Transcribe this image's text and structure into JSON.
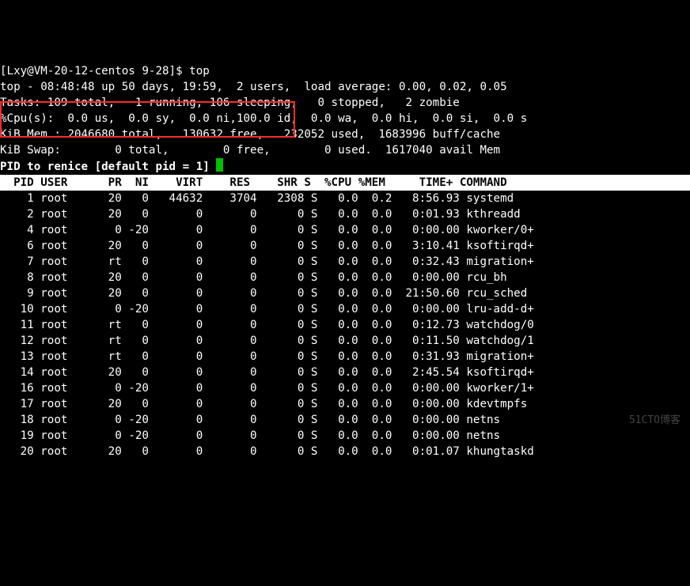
{
  "promptLine": "[Lxy@VM-20-12-centos 9-28]$ top",
  "summary": {
    "l1a": "top - 08:48:48 up 50 days, 19:59,  2 users,  load average: 0.00, 0.02, 0.05",
    "l2": "Tasks: 109 total,   1 running, 106 sleeping,   0 stopped,   2 zombie",
    "l3": "%Cpu(s):  0.0 us,  0.0 sy,  0.0 ni,100.0 id,  0.0 wa,  0.0 hi,  0.0 si,  0.0 s",
    "l4": "KiB Mem : 2046680 total,   130632 free,   232052 used,  1683996 buff/cache",
    "l5": "KiB Swap:        0 total,        0 free,        0 used.  1617040 avail Mem"
  },
  "renicePrompt": "PID to renice [default pid = 1] ",
  "columns": "  PID USER      PR  NI    VIRT    RES    SHR S  %CPU %MEM     TIME+ COMMAND   ",
  "rows": [
    {
      "pid": "1",
      "user": "root",
      "pr": "20",
      "ni": "0",
      "virt": "44632",
      "res": "3704",
      "shr": "2308",
      "s": "S",
      "cpu": "0.0",
      "mem": "0.2",
      "time": "8:56.93",
      "cmd": "systemd"
    },
    {
      "pid": "2",
      "user": "root",
      "pr": "20",
      "ni": "0",
      "virt": "0",
      "res": "0",
      "shr": "0",
      "s": "S",
      "cpu": "0.0",
      "mem": "0.0",
      "time": "0:01.93",
      "cmd": "kthreadd"
    },
    {
      "pid": "4",
      "user": "root",
      "pr": "0",
      "ni": "-20",
      "virt": "0",
      "res": "0",
      "shr": "0",
      "s": "S",
      "cpu": "0.0",
      "mem": "0.0",
      "time": "0:00.00",
      "cmd": "kworker/0+"
    },
    {
      "pid": "6",
      "user": "root",
      "pr": "20",
      "ni": "0",
      "virt": "0",
      "res": "0",
      "shr": "0",
      "s": "S",
      "cpu": "0.0",
      "mem": "0.0",
      "time": "3:10.41",
      "cmd": "ksoftirqd+"
    },
    {
      "pid": "7",
      "user": "root",
      "pr": "rt",
      "ni": "0",
      "virt": "0",
      "res": "0",
      "shr": "0",
      "s": "S",
      "cpu": "0.0",
      "mem": "0.0",
      "time": "0:32.43",
      "cmd": "migration+"
    },
    {
      "pid": "8",
      "user": "root",
      "pr": "20",
      "ni": "0",
      "virt": "0",
      "res": "0",
      "shr": "0",
      "s": "S",
      "cpu": "0.0",
      "mem": "0.0",
      "time": "0:00.00",
      "cmd": "rcu_bh"
    },
    {
      "pid": "9",
      "user": "root",
      "pr": "20",
      "ni": "0",
      "virt": "0",
      "res": "0",
      "shr": "0",
      "s": "S",
      "cpu": "0.0",
      "mem": "0.0",
      "time": "21:50.60",
      "cmd": "rcu_sched"
    },
    {
      "pid": "10",
      "user": "root",
      "pr": "0",
      "ni": "-20",
      "virt": "0",
      "res": "0",
      "shr": "0",
      "s": "S",
      "cpu": "0.0",
      "mem": "0.0",
      "time": "0:00.00",
      "cmd": "lru-add-d+"
    },
    {
      "pid": "11",
      "user": "root",
      "pr": "rt",
      "ni": "0",
      "virt": "0",
      "res": "0",
      "shr": "0",
      "s": "S",
      "cpu": "0.0",
      "mem": "0.0",
      "time": "0:12.73",
      "cmd": "watchdog/0"
    },
    {
      "pid": "12",
      "user": "root",
      "pr": "rt",
      "ni": "0",
      "virt": "0",
      "res": "0",
      "shr": "0",
      "s": "S",
      "cpu": "0.0",
      "mem": "0.0",
      "time": "0:11.50",
      "cmd": "watchdog/1"
    },
    {
      "pid": "13",
      "user": "root",
      "pr": "rt",
      "ni": "0",
      "virt": "0",
      "res": "0",
      "shr": "0",
      "s": "S",
      "cpu": "0.0",
      "mem": "0.0",
      "time": "0:31.93",
      "cmd": "migration+"
    },
    {
      "pid": "14",
      "user": "root",
      "pr": "20",
      "ni": "0",
      "virt": "0",
      "res": "0",
      "shr": "0",
      "s": "S",
      "cpu": "0.0",
      "mem": "0.0",
      "time": "2:45.54",
      "cmd": "ksoftirqd+"
    },
    {
      "pid": "16",
      "user": "root",
      "pr": "0",
      "ni": "-20",
      "virt": "0",
      "res": "0",
      "shr": "0",
      "s": "S",
      "cpu": "0.0",
      "mem": "0.0",
      "time": "0:00.00",
      "cmd": "kworker/1+"
    },
    {
      "pid": "17",
      "user": "root",
      "pr": "20",
      "ni": "0",
      "virt": "0",
      "res": "0",
      "shr": "0",
      "s": "S",
      "cpu": "0.0",
      "mem": "0.0",
      "time": "0:00.00",
      "cmd": "kdevtmpfs"
    },
    {
      "pid": "18",
      "user": "root",
      "pr": "0",
      "ni": "-20",
      "virt": "0",
      "res": "0",
      "shr": "0",
      "s": "S",
      "cpu": "0.0",
      "mem": "0.0",
      "time": "0:00.00",
      "cmd": "netns"
    },
    {
      "pid": "19",
      "user": "root",
      "pr": "0",
      "ni": "-20",
      "virt": "0",
      "res": "0",
      "shr": "0",
      "s": "S",
      "cpu": "0.0",
      "mem": "0.0",
      "time": "0:00.00",
      "cmd": "netns"
    },
    {
      "pid": "20",
      "user": "root",
      "pr": "20",
      "ni": "0",
      "virt": "0",
      "res": "0",
      "shr": "0",
      "s": "S",
      "cpu": "0.0",
      "mem": "0.0",
      "time": "0:01.07",
      "cmd": "khungtaskd"
    }
  ],
  "watermark": "51CTO博客"
}
